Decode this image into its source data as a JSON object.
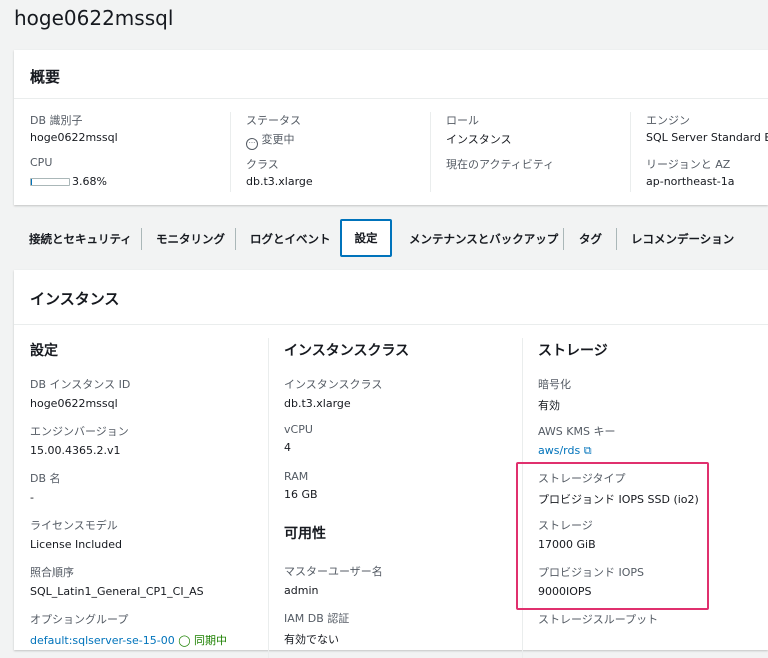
{
  "title": "hoge0622mssql",
  "overview": {
    "header": "概要",
    "db_id_label": "DB 識別子",
    "db_id": "hoge0622mssql",
    "cpu_label": "CPU",
    "cpu_value": "3.68%",
    "cpu_percent": 3.68,
    "status_label": "ステータス",
    "status": "変更中",
    "class_label": "クラス",
    "class": "db.t3.xlarge",
    "role_label": "ロール",
    "role": "インスタンス",
    "activity_label": "現在のアクティビティ",
    "engine_label": "エンジン",
    "engine": "SQL Server Standard Edit",
    "region_label": "リージョンと AZ",
    "region": "ap-northeast-1a"
  },
  "tabs": [
    "接続とセキュリティ",
    "モニタリング",
    "ログとイベント",
    "設定",
    "メンテナンスとバックアップ",
    "タグ",
    "レコメンデーション"
  ],
  "active_tab": "設定",
  "instance": {
    "header": "インスタンス",
    "config": {
      "title": "設定",
      "items": [
        {
          "label": "DB インスタンス ID",
          "value": "hoge0622mssql"
        },
        {
          "label": "エンジンバージョン",
          "value": "15.00.4365.2.v1"
        },
        {
          "label": "DB 名",
          "value": "-"
        },
        {
          "label": "ライセンスモデル",
          "value": "License Included"
        },
        {
          "label": "照合順序",
          "value": "SQL_Latin1_General_CP1_CI_AS"
        },
        {
          "label": "オプショングループ",
          "value": "default:sqlserver-se-15-00",
          "status": "同期中"
        }
      ]
    },
    "class": {
      "title": "インスタンスクラス",
      "items": [
        {
          "label": "インスタンスクラス",
          "value": "db.t3.xlarge"
        },
        {
          "label": "vCPU",
          "value": "4"
        },
        {
          "label": "RAM",
          "value": "16 GB"
        }
      ],
      "availability_title": "可用性",
      "availability_items": [
        {
          "label": "マスターユーザー名",
          "value": "admin"
        },
        {
          "label": "IAM DB 認証",
          "value": "有効でない"
        }
      ]
    },
    "storage": {
      "title": "ストレージ",
      "items": [
        {
          "label": "暗号化",
          "value": "有効"
        },
        {
          "label": "AWS KMS キー",
          "value": "aws/rds"
        },
        {
          "label": "ストレージタイプ",
          "value": "プロビジョンド IOPS SSD (io2)"
        },
        {
          "label": "ストレージ",
          "value": "17000 GiB"
        },
        {
          "label": "プロビジョンド IOPS",
          "value": "9000IOPS"
        },
        {
          "label": "ストレージスループット"
        }
      ]
    }
  },
  "colors": {
    "highlight": "#e0306e",
    "link": "#0073bb",
    "active_tab": "#0073bb"
  }
}
